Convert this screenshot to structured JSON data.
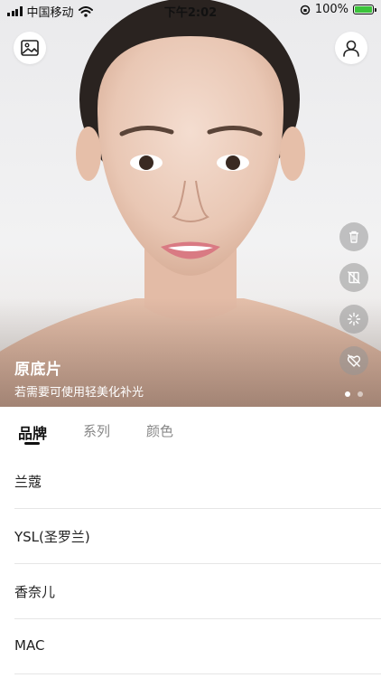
{
  "status_bar": {
    "carrier": "中国移动",
    "time": "下午2:02",
    "battery": "100%"
  },
  "photo": {
    "caption_title": "原底片",
    "caption_subtitle": "若需要可使用轻美化补光",
    "page_indicator": {
      "count": 2,
      "active_index": 0
    }
  },
  "tabs": [
    {
      "label": "品牌",
      "active": true
    },
    {
      "label": "系列",
      "active": false
    },
    {
      "label": "颜色",
      "active": false
    }
  ],
  "brands": [
    {
      "label": "兰蔻"
    },
    {
      "label": "YSL(圣罗兰)"
    },
    {
      "label": "香奈儿"
    },
    {
      "label": "MAC"
    }
  ],
  "icons": {
    "gallery": "image-gallery-icon",
    "profile": "user-profile-icon",
    "side": [
      "trash-icon",
      "compare-off-icon",
      "sparkle-icon",
      "heart-off-icon"
    ]
  },
  "colors": {
    "battery": "#3bc43b",
    "text_primary": "#111111",
    "tab_inactive": "#888888"
  }
}
